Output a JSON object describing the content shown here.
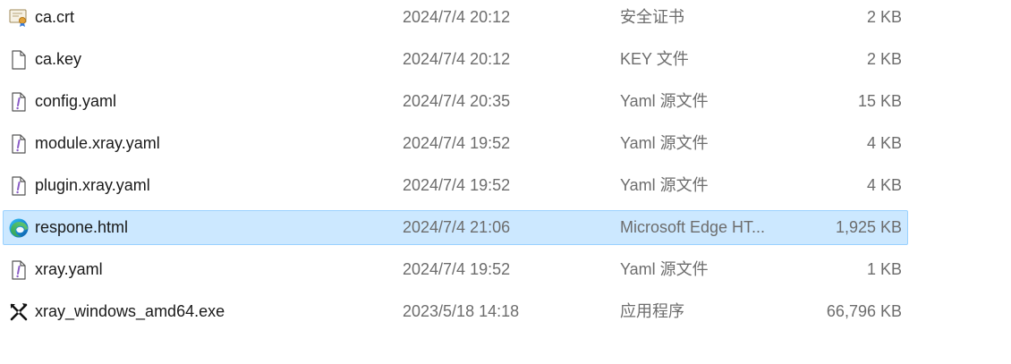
{
  "files": [
    {
      "name": "ca.crt",
      "date": "2024/7/4 20:12",
      "type": "安全证书",
      "size": "2 KB",
      "icon": "certificate-icon",
      "selected": false
    },
    {
      "name": "ca.key",
      "date": "2024/7/4 20:12",
      "type": "KEY 文件",
      "size": "2 KB",
      "icon": "blank-file-icon",
      "selected": false
    },
    {
      "name": "config.yaml",
      "date": "2024/7/4 20:35",
      "type": "Yaml 源文件",
      "size": "15 KB",
      "icon": "yaml-file-icon",
      "selected": false
    },
    {
      "name": "module.xray.yaml",
      "date": "2024/7/4 19:52",
      "type": "Yaml 源文件",
      "size": "4 KB",
      "icon": "yaml-file-icon",
      "selected": false
    },
    {
      "name": "plugin.xray.yaml",
      "date": "2024/7/4 19:52",
      "type": "Yaml 源文件",
      "size": "4 KB",
      "icon": "yaml-file-icon",
      "selected": false
    },
    {
      "name": "respone.html",
      "date": "2024/7/4 21:06",
      "type": "Microsoft Edge HT...",
      "size": "1,925 KB",
      "icon": "edge-icon",
      "selected": true
    },
    {
      "name": "xray.yaml",
      "date": "2024/7/4 19:52",
      "type": "Yaml 源文件",
      "size": "1 KB",
      "icon": "yaml-file-icon",
      "selected": false
    },
    {
      "name": "xray_windows_amd64.exe",
      "date": "2023/5/18 14:18",
      "type": "应用程序",
      "size": "66,796 KB",
      "icon": "executable-icon",
      "selected": false
    }
  ],
  "colors": {
    "selection_bg": "#cce8ff",
    "selection_border": "#99d1ff",
    "secondary_text": "#6d6d6d",
    "yaml_accent": "#8a5cc7"
  }
}
